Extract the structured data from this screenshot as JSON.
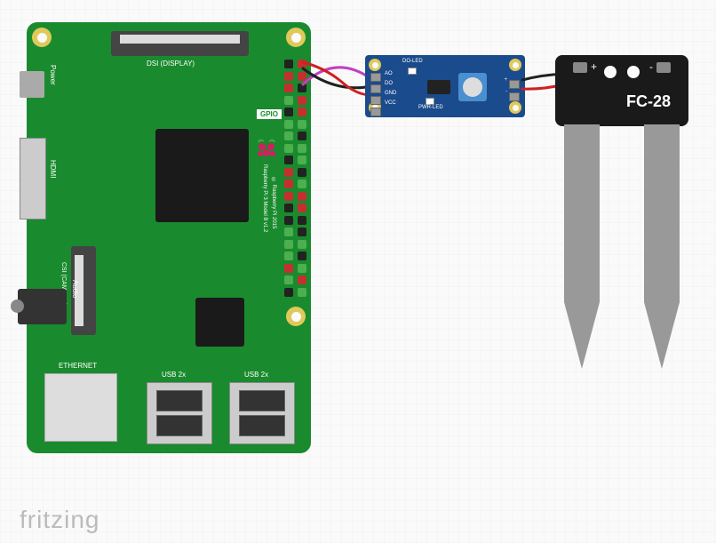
{
  "diagram": {
    "tool_logo": "fritzing",
    "components": {
      "raspberry_pi": {
        "dsi_label": "DSI (DISPLAY)",
        "csi_label": "CSI (CAMERA)",
        "power_label": "Power",
        "hdmi_label": "HDMI",
        "audio_label": "Audio",
        "ethernet_label": "ETHERNET",
        "usb_label_1": "USB 2x",
        "usb_label_2": "USB 2x",
        "gpio_badge": "GPIO",
        "model_line1": "Raspberry Pi 3 Model B v1.2",
        "model_line2": "© Raspberry Pi 2015"
      },
      "soil_sensor_module": {
        "pin_ao": "AO",
        "pin_do": "DO",
        "pin_gnd": "GND",
        "pin_vcc": "VCC",
        "led1": "DO-LED",
        "led2": "PWR-LED",
        "out_plus": "+",
        "out_minus": "-"
      },
      "soil_probe": {
        "label": "FC-28",
        "pad_plus": "+",
        "pad_minus": "-"
      }
    },
    "wires": [
      {
        "name": "pi-vcc-to-sensor-vcc",
        "color": "#d02020"
      },
      {
        "name": "pi-gnd-to-sensor-gnd",
        "color": "#202020"
      },
      {
        "name": "pi-gpio-to-sensor-do",
        "color": "#c040c0"
      },
      {
        "name": "sensor-plus-to-probe-plus",
        "color": "#d02020"
      },
      {
        "name": "sensor-minus-to-probe-minus",
        "color": "#202020"
      }
    ]
  }
}
